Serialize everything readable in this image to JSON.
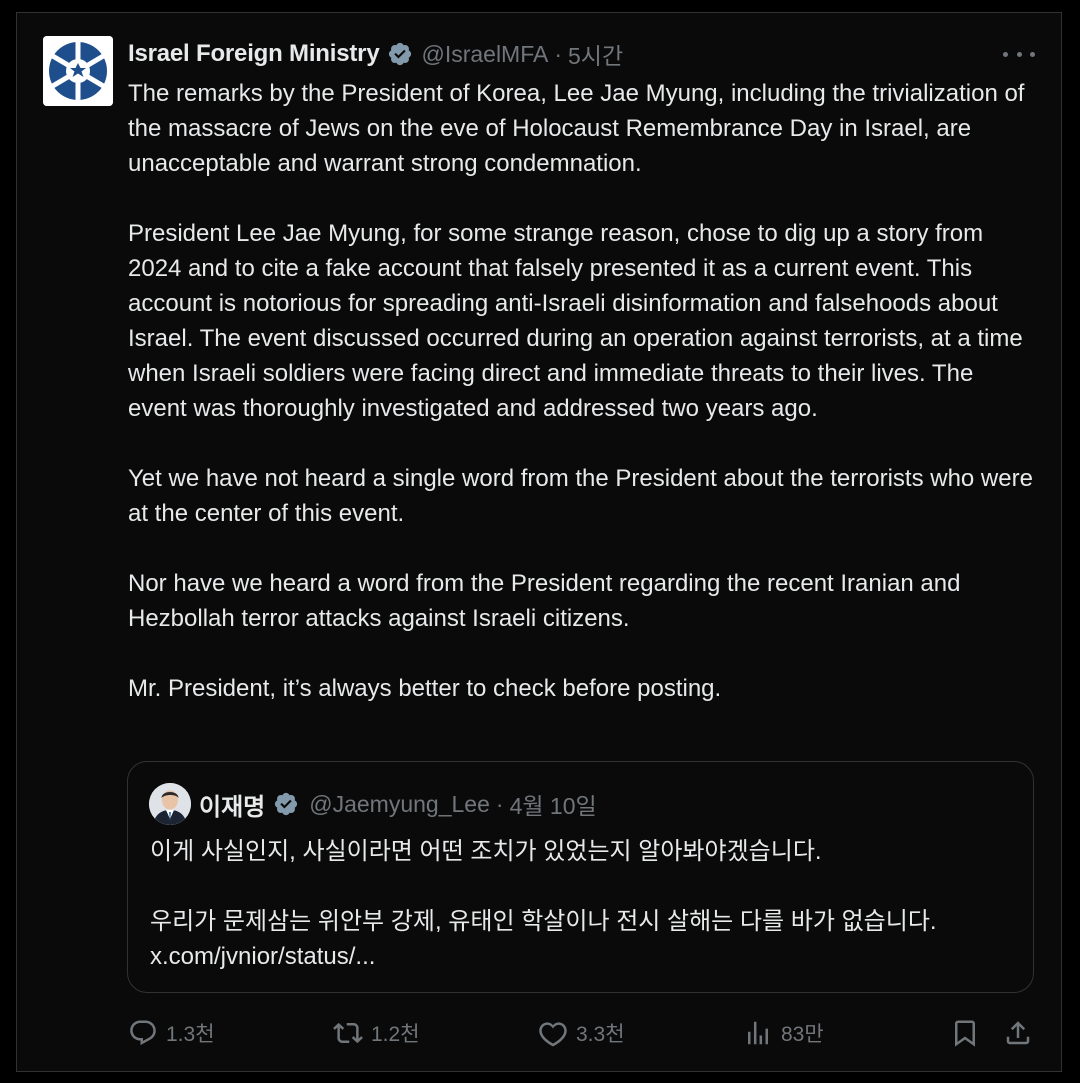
{
  "tweet": {
    "author_name": "Israel Foreign Ministry",
    "author_handle": "@IsraelMFA",
    "separator": "·",
    "time": "5시간",
    "paragraphs": [
      "The remarks by the President of Korea, Lee Jae Myung, including the trivialization of the massacre of Jews on the eve of Holocaust Remembrance Day in Israel, are unacceptable and warrant strong condemnation.",
      "President Lee Jae Myung, for some strange reason, chose to dig up a story from 2024 and to cite a fake account that falsely presented it as a current event. This account is notorious for spreading anti-Israeli disinformation and falsehoods about Israel. The event discussed occurred during an operation against terrorists, at a time when Israeli soldiers were facing direct and immediate threats to their lives. The event was thoroughly investigated and addressed two years ago.",
      "Yet we have not heard a single word from the President about the terrorists who were at the center of this event.",
      "Nor have we heard a word from the President regarding the recent Iranian and Hezbollah terror attacks against Israeli citizens.",
      "Mr. President, it’s always better to check before posting."
    ]
  },
  "quoted_tweet": {
    "author_name": "이재명",
    "author_handle": "@Jaemyung_Lee",
    "separator": "·",
    "time": "4월 10일",
    "paragraphs": [
      "이게 사실인지, 사실이라면 어떤 조치가 있었는지 알아봐야겠습니다.",
      "우리가 문제삼는 위안부 강제, 유태인 학살이나 전시 살해는 다를 바가 없습니다.\nx.com/jvnior/status/..."
    ]
  },
  "actions": {
    "replies": "1.3천",
    "reposts": "1.2천",
    "likes": "3.3천",
    "views": "83만"
  },
  "icons": {
    "more": "more-horizontal-icon",
    "verified": "verified-badge-icon",
    "reply": "reply-icon",
    "repost": "repost-icon",
    "like": "heart-icon",
    "views": "views-chart-icon",
    "bookmark": "bookmark-icon",
    "share": "share-icon"
  },
  "colors": {
    "background": "#000000",
    "text": "#e7e9ea",
    "muted": "#71767b",
    "border": "#2f3336",
    "verified_gray": "#829aab",
    "ministry_blue": "#1f4e8c"
  }
}
